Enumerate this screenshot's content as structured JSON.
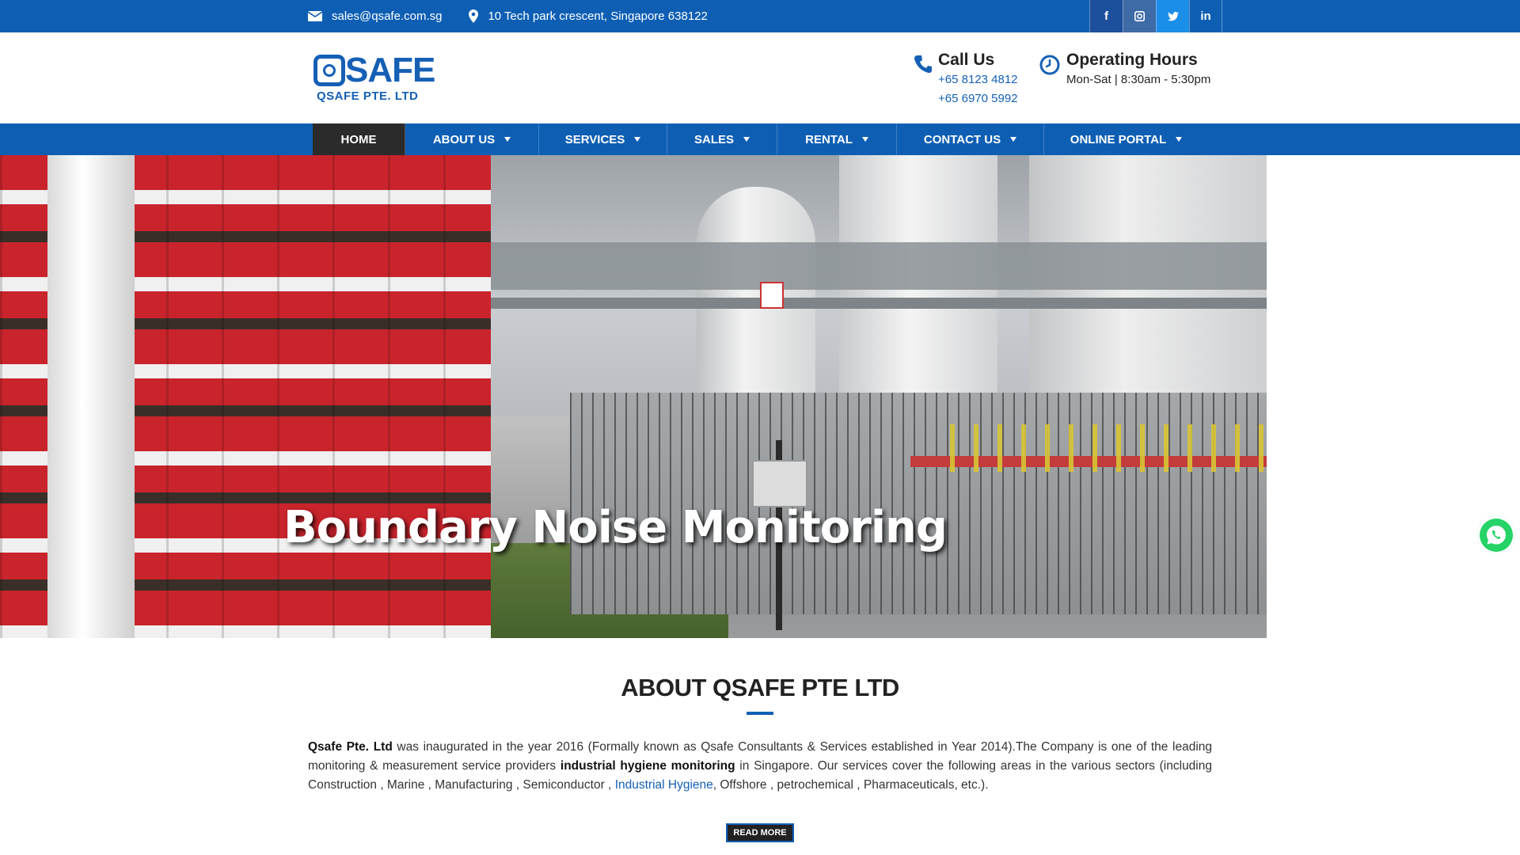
{
  "topbar": {
    "email": "sales@qsafe.com.sg",
    "address": "10 Tech park crescent, Singapore 638122",
    "social": [
      {
        "name": "facebook-icon",
        "glyph": "f"
      },
      {
        "name": "instagram-icon",
        "glyph": "◙"
      },
      {
        "name": "twitter-icon",
        "glyph": "🐦"
      },
      {
        "name": "linkedin-icon",
        "glyph": "in"
      }
    ]
  },
  "header": {
    "logo_word": "SAFE",
    "logo_sub": "QSAFE PTE. LTD",
    "call_title": "Call Us",
    "phone1": "+65 8123 4812",
    "phone2": "+65 6970 5992",
    "hours_title": "Operating Hours",
    "hours_text": "Mon-Sat | 8:30am - 5:30pm"
  },
  "nav": {
    "items": [
      {
        "label": "HOME",
        "active": true
      },
      {
        "label": "ABOUT US",
        "caret": true
      },
      {
        "label": "SERVICES",
        "caret": true
      },
      {
        "label": "SALES",
        "caret": true
      },
      {
        "label": "RENTAL",
        "caret": true
      },
      {
        "label": "CONTACT US",
        "caret": true
      },
      {
        "label": "ONLINE PORTAL",
        "caret": true
      }
    ]
  },
  "hero": {
    "caption": "Boundary Noise Monitoring"
  },
  "about": {
    "title": "ABOUT QSAFE PTE LTD",
    "company": "Qsafe Pte. Ltd",
    "text1": " was inaugurated in the year 2016 (Formally known as Qsafe Consultants & Services established in Year 2014).The Company is one of the leading monitoring & measurement service providers ",
    "bold2": "industrial hygiene monitoring",
    "text2": " in Singapore. Our services cover the following areas in the various sectors (including Construction , Marine , Manufacturing , Semiconductor , ",
    "link": "Industrial Hygiene",
    "text3": ", Offshore , petrochemical , Pharmaceuticals, etc.).",
    "read_more": "READ MORE"
  },
  "colors": {
    "brand_blue": "#0e5fb4",
    "active_nav": "#2b2b2b",
    "whatsapp": "#25d366"
  }
}
